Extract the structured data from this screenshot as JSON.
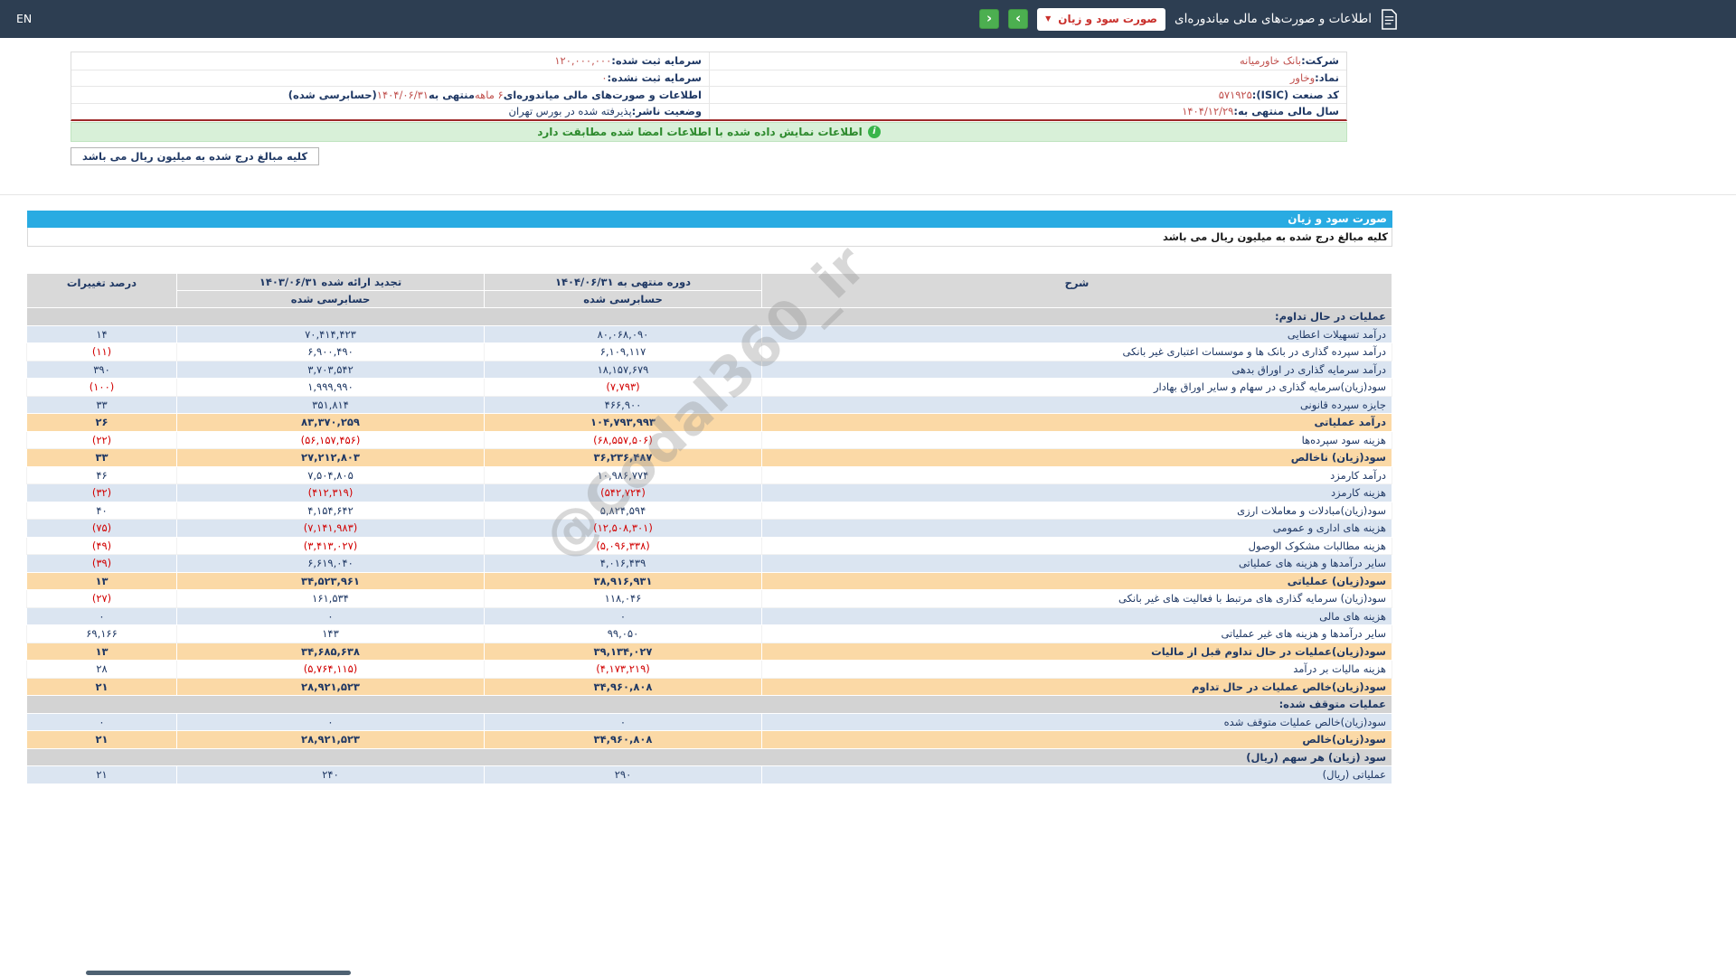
{
  "topbar": {
    "title": "اطلاعات و صورت‌های مالی میاندوره‌ای",
    "report_select": "صورت سود و زیان",
    "nav_forward": "›",
    "nav_back": "‹",
    "language": "EN"
  },
  "company_info": {
    "rows": [
      {
        "right": [
          {
            "t": "شرکت:  ",
            "cls": "lbl"
          },
          {
            "t": "بانک خاورمیانه",
            "cls": "val"
          }
        ],
        "left": [
          {
            "t": "سرمایه ثبت شده:  ",
            "cls": "lbl"
          },
          {
            "t": "۱۲۰,۰۰۰,۰۰۰",
            "cls": "val"
          }
        ]
      },
      {
        "right": [
          {
            "t": "نماد:  ",
            "cls": "lbl"
          },
          {
            "t": "وخاور",
            "cls": "val"
          }
        ],
        "left": [
          {
            "t": "سرمایه ثبت نشده:  ",
            "cls": "lbl"
          },
          {
            "t": "۰",
            "cls": "val"
          }
        ]
      },
      {
        "right": [
          {
            "t": "کد صنعت (ISIC):  ",
            "cls": "lbl"
          },
          {
            "t": "۵۷۱۹۲۵",
            "cls": "val"
          }
        ],
        "left": [
          {
            "t": "اطلاعات و صورت‌های مالی میاندوره‌ای ",
            "cls": "lbl"
          },
          {
            "t": "۶ ماهه",
            "cls": "val"
          },
          {
            "t": " منتهی به ",
            "cls": "lbl"
          },
          {
            "t": "۱۴۰۴/۰۶/۳۱",
            "cls": "val"
          },
          {
            "t": "(حسابرسی شده)",
            "cls": "lbl"
          }
        ]
      },
      {
        "right": [
          {
            "t": "سال مالی منتهی به:  ",
            "cls": "lbl"
          },
          {
            "t": "۱۴۰۴/۱۲/۲۹",
            "cls": "val"
          }
        ],
        "left": [
          {
            "t": "وضعیت ناشر:  ",
            "cls": "lbl"
          },
          {
            "t": "پذیرفته شده در بورس تهران",
            "cls": "lbl2"
          }
        ]
      }
    ]
  },
  "signature_banner": "اطلاعات نمایش داده شده با اطلاعات امضا شده مطابقت دارد",
  "units_note": "کلیه مبالغ درج شده به میلیون ریال می باشد",
  "statement": {
    "title": "صورت سود و زیان",
    "units_note": "کلیه مبالغ درج شده به میلیون ریال می باشد",
    "columns": {
      "description": "شرح",
      "current_period": "دوره منتهی به ۱۴۰۴/۰۶/۳۱",
      "current_audited": "حسابرسی شده",
      "prior_period": "تجدید ارائه شده ۱۴۰۳/۰۶/۳۱",
      "prior_audited": "حسابرسی شده",
      "change_percent": "درصد تغییرات"
    },
    "rows": [
      {
        "cls": "section",
        "label": "عملیات در حال تداوم:"
      },
      {
        "cls": "blue",
        "label": "درآمد تسهیلات اعطایی",
        "v1": "۸۰,۰۶۸,۰۹۰",
        "v2": "۷۰,۴۱۴,۴۲۳",
        "pct": "۱۴"
      },
      {
        "cls": "white",
        "label": "درآمد سپرده گذاری در بانک ها و موسسات اعتباری غیر بانکی",
        "v1": "۶,۱۰۹,۱۱۷",
        "v2": "۶,۹۰۰,۴۹۰",
        "pct": "(۱۱)",
        "np": true
      },
      {
        "cls": "blue",
        "label": "درآمد سرمایه گذاری در اوراق بدهی",
        "v1": "۱۸,۱۵۷,۶۷۹",
        "v2": "۳,۷۰۳,۵۴۲",
        "pct": "۳۹۰"
      },
      {
        "cls": "white",
        "label": "سود(زیان)سرمایه گذاری در سهام و سایر اوراق بهادار",
        "v1": "(۷,۷۹۳)",
        "n1": true,
        "v2": "۱,۹۹۹,۹۹۰",
        "pct": "(۱۰۰)",
        "np": true
      },
      {
        "cls": "blue",
        "label": "جایزه سپرده قانونی",
        "v1": "۴۶۶,۹۰۰",
        "v2": "۳۵۱,۸۱۴",
        "pct": "۳۳"
      },
      {
        "cls": "yellow",
        "label": "درآمد عملیاتی",
        "v1": "۱۰۴,۷۹۳,۹۹۳",
        "v2": "۸۳,۳۷۰,۲۵۹",
        "pct": "۲۶"
      },
      {
        "cls": "white",
        "label": "هزینه سود سپرده‌ها",
        "v1": "(۶۸,۵۵۷,۵۰۶)",
        "n1": true,
        "v2": "(۵۶,۱۵۷,۴۵۶)",
        "n2": true,
        "pct": "(۲۲)",
        "np": true
      },
      {
        "cls": "yellow",
        "label": "سود(زیان) ناخالص",
        "v1": "۳۶,۲۳۶,۴۸۷",
        "v2": "۲۷,۲۱۲,۸۰۳",
        "pct": "۳۳"
      },
      {
        "cls": "white",
        "label": "درآمد کارمزد",
        "v1": "۱۰,۹۸۶,۷۷۴",
        "v2": "۷,۵۰۴,۸۰۵",
        "pct": "۴۶"
      },
      {
        "cls": "blue",
        "label": "هزینه کارمزد",
        "v1": "(۵۴۲,۷۲۴)",
        "n1": true,
        "v2": "(۴۱۲,۳۱۹)",
        "n2": true,
        "pct": "(۳۲)",
        "np": true
      },
      {
        "cls": "white",
        "label": "سود(زیان)مبادلات و معاملات ارزی",
        "v1": "۵,۸۲۴,۵۹۴",
        "v2": "۴,۱۵۴,۶۴۲",
        "pct": "۴۰"
      },
      {
        "cls": "blue",
        "label": "هزینه های اداری و عمومی",
        "v1": "(۱۲,۵۰۸,۳۰۱)",
        "n1": true,
        "v2": "(۷,۱۴۱,۹۸۳)",
        "n2": true,
        "pct": "(۷۵)",
        "np": true
      },
      {
        "cls": "white",
        "label": "هزینه مطالبات مشکوک الوصول",
        "v1": "(۵,۰۹۶,۳۳۸)",
        "n1": true,
        "v2": "(۳,۴۱۳,۰۲۷)",
        "n2": true,
        "pct": "(۴۹)",
        "np": true
      },
      {
        "cls": "blue",
        "label": "سایر درآمدها و هزینه های عملیاتی",
        "v1": "۴,۰۱۶,۴۳۹",
        "v2": "۶,۶۱۹,۰۴۰",
        "pct": "(۳۹)",
        "np": true
      },
      {
        "cls": "yellow",
        "label": "سود(زیان) عملیاتی",
        "v1": "۳۸,۹۱۶,۹۳۱",
        "v2": "۳۴,۵۲۳,۹۶۱",
        "pct": "۱۳"
      },
      {
        "cls": "white",
        "label": "سود(زیان) سرمایه گذاری های مرتبط با فعالیت های غیر بانکی",
        "v1": "۱۱۸,۰۴۶",
        "v2": "۱۶۱,۵۳۴",
        "pct": "(۲۷)",
        "np": true
      },
      {
        "cls": "blue",
        "label": "هزینه های مالی",
        "v1": "۰",
        "v2": "۰",
        "pct": "۰"
      },
      {
        "cls": "white",
        "label": "سایر درآمدها و هزینه های غیر عملیاتی",
        "v1": "۹۹,۰۵۰",
        "v2": "۱۴۳",
        "pct": "۶۹,۱۶۶"
      },
      {
        "cls": "yellow",
        "label": "سود(زیان)عملیات در حال تداوم قبل از مالیات",
        "v1": "۳۹,۱۳۴,۰۲۷",
        "v2": "۳۴,۶۸۵,۶۳۸",
        "pct": "۱۳"
      },
      {
        "cls": "white",
        "label": "هزینه مالیات بر درآمد",
        "v1": "(۴,۱۷۳,۲۱۹)",
        "n1": true,
        "v2": "(۵,۷۶۴,۱۱۵)",
        "n2": true,
        "pct": "۲۸"
      },
      {
        "cls": "yellow",
        "label": "سود(زیان)خالص عملیات در حال تداوم",
        "v1": "۳۴,۹۶۰,۸۰۸",
        "v2": "۲۸,۹۲۱,۵۲۳",
        "pct": "۲۱"
      },
      {
        "cls": "section",
        "label": "عملیات متوقف شده:"
      },
      {
        "cls": "blue",
        "label": "سود(زیان)خالص عملیات متوقف شده",
        "v1": "۰",
        "v2": "۰",
        "pct": "۰"
      },
      {
        "cls": "yellow",
        "label": "سود(زیان)خالص",
        "v1": "۳۴,۹۶۰,۸۰۸",
        "v2": "۲۸,۹۲۱,۵۲۳",
        "pct": "۲۱"
      },
      {
        "cls": "section",
        "label": "سود (زیان) هر سهم (ریال)"
      },
      {
        "cls": "blue",
        "label": "عملیاتی (ریال)",
        "v1": "۲۹۰",
        "v2": "۲۴۰",
        "pct": "۲۱"
      }
    ]
  },
  "watermark": "@Codal360_ir",
  "colors": {
    "topbar": "#2d3e52",
    "accent_blue": "#29abe2",
    "green_button": "#4caf50",
    "banner_green_bg": "#d8f0d8",
    "label_navy": "#1f3864",
    "value_orange": "#c0504d",
    "negative_red": "#d10000",
    "row_blue": "#dbe5f1",
    "row_yellow": "#fbd9a6",
    "section_gray": "#d3d3d3"
  }
}
